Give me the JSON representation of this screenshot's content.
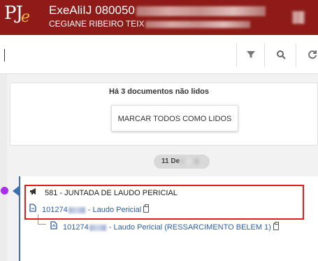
{
  "header": {
    "title": "ExeAliIJ 080050",
    "subtitle": "CEGIANE RIBEIRO TEIX",
    "logo_main": "PJ",
    "logo_accent": "e"
  },
  "toolbar": {
    "icons": [
      "filter-icon",
      "search-icon",
      "refresh-icon"
    ]
  },
  "unread": {
    "message": "Há 3 documentos não lidos",
    "mark_all_label": "MARCAR TODOS COMO LIDOS"
  },
  "timeline": {
    "date_label": "11 De",
    "event": {
      "title": "581 - JUNTADA DE LAUDO PERICIAL",
      "document_id": "101274",
      "document_label": "- Laudo Pericial",
      "child_id": "101274",
      "child_label": "- Laudo Pericial (RESSARCIMENTO BELEM 1)"
    }
  },
  "colors": {
    "header_bg": "#8e1b17",
    "link": "#2d5fa8",
    "timeline": "#3b6fb0",
    "highlight": "#e21b1b",
    "dot": "#a92cf0"
  }
}
